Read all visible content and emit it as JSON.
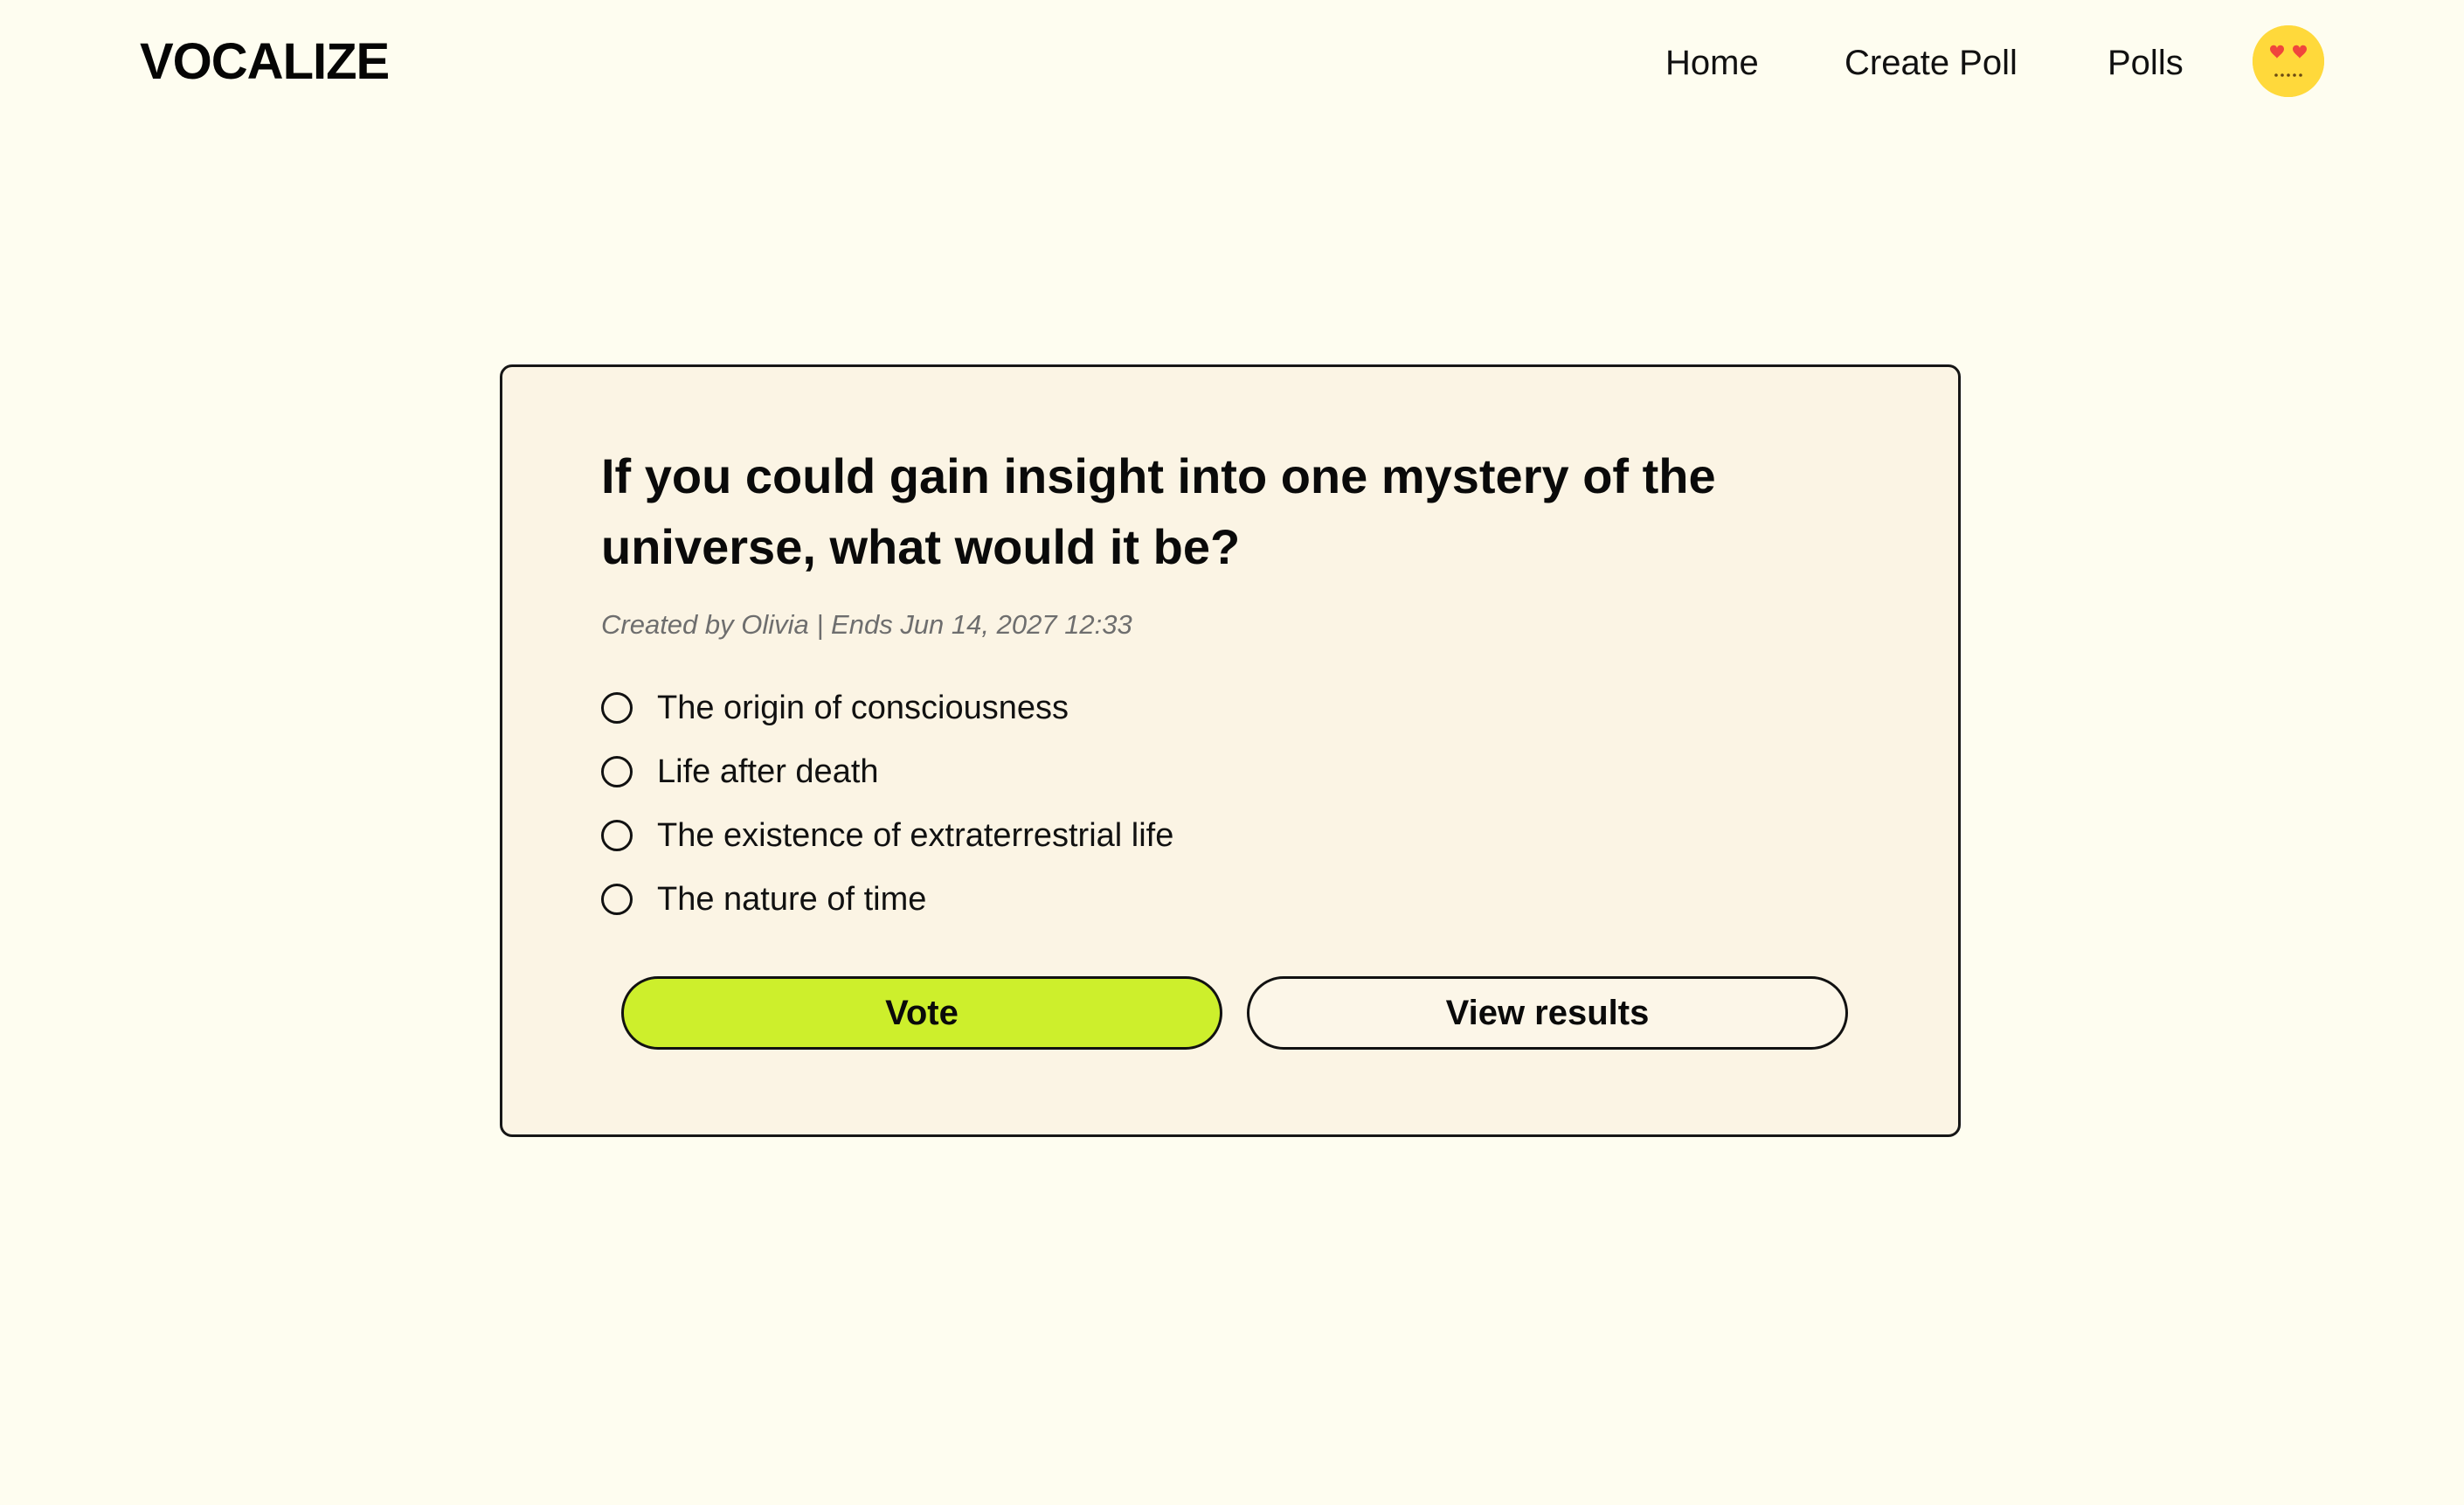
{
  "app": {
    "logo": "VOCALIZE"
  },
  "nav": {
    "items": [
      {
        "label": "Home"
      },
      {
        "label": "Create Poll"
      },
      {
        "label": "Polls"
      }
    ],
    "avatar_icon": "heart-eyes-face-icon"
  },
  "poll": {
    "question": "If you could gain insight into one mystery of the universe, what would it be?",
    "meta": "Created by Olivia | Ends Jun 14, 2027 12:33",
    "options": [
      {
        "label": "The origin of consciousness",
        "selected": false
      },
      {
        "label": "Life after death",
        "selected": false
      },
      {
        "label": "The existence of extraterrestrial life",
        "selected": false
      },
      {
        "label": "The nature of time",
        "selected": false
      }
    ],
    "vote_label": "Vote",
    "results_label": "View results"
  },
  "colors": {
    "background": "#fefdf0",
    "card_background": "#fbf4e4",
    "accent": "#cdef2c",
    "avatar": "#ffd93b"
  }
}
